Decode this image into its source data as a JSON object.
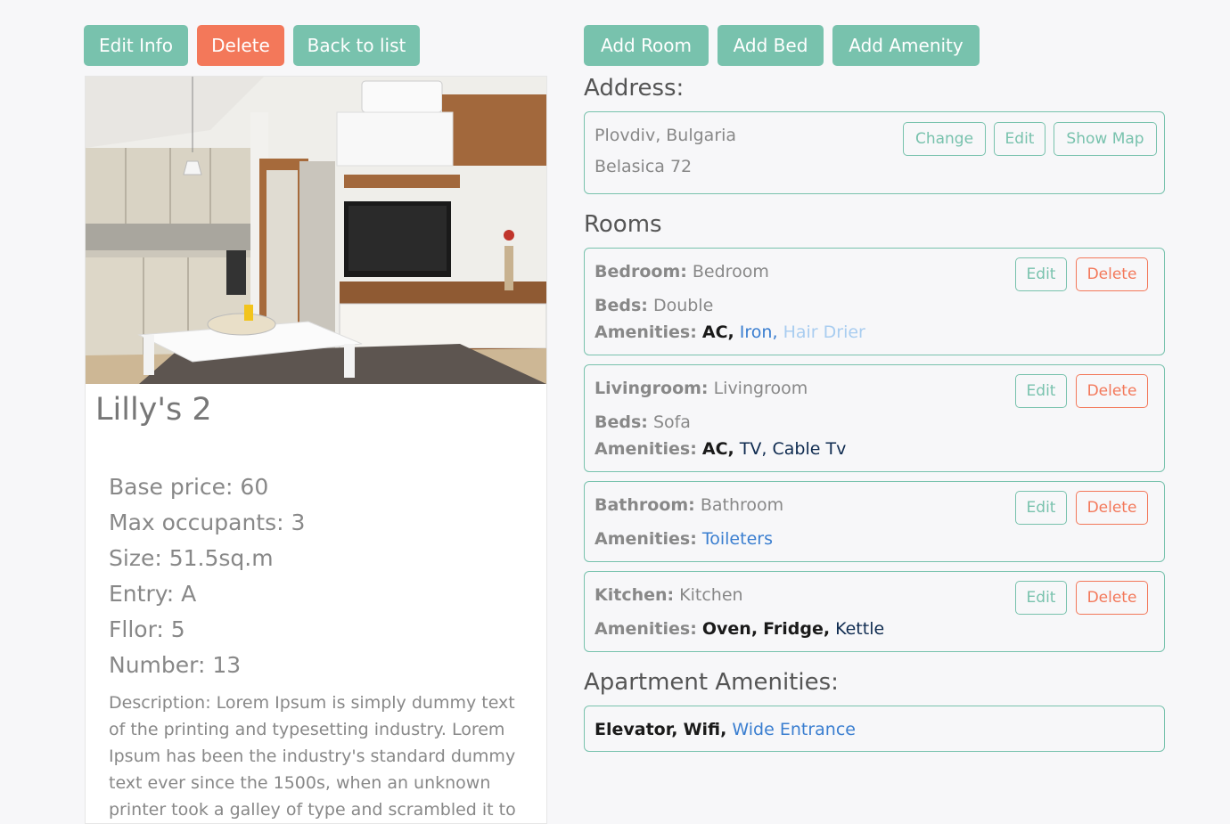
{
  "left_toolbar": {
    "edit_info": "Edit Info",
    "delete": "Delete",
    "back_to_list": "Back to list"
  },
  "right_toolbar": {
    "add_room": "Add Room",
    "add_bed": "Add Bed",
    "add_amenity": "Add Amenity"
  },
  "apartment": {
    "title": "Lilly's 2",
    "base_price": "Base price: 60",
    "max_occupants": "Max occupants: 3",
    "size": "Size: 51.5sq.m",
    "entry": "Entry: A",
    "floor": "Fllor: 5",
    "number": "Number: 13",
    "description": "Description: Lorem Ipsum is simply dummy text of the printing and typesetting industry. Lorem Ipsum has been the industry's standard dummy text ever since the 1500s, when an unknown printer took a galley of type and scrambled it to make a type"
  },
  "address": {
    "heading": "Address:",
    "city": "Plovdiv, Bulgaria",
    "street": "Belasica 72",
    "change": "Change",
    "edit": "Edit",
    "show_map": "Show Map"
  },
  "rooms": {
    "heading": "Rooms",
    "beds_label": "Beds:",
    "amenities_label": "Amenities:",
    "edit": "Edit",
    "delete": "Delete",
    "items": [
      {
        "type": "Bedroom:",
        "name": "Bedroom",
        "beds": "Double",
        "amenities": [
          "AC,",
          "Iron,",
          "Hair Drier"
        ]
      },
      {
        "type": "Livingroom:",
        "name": "Livingroom",
        "beds": "Sofa",
        "amenities": [
          "AC,",
          "TV,",
          "Cable Tv"
        ]
      },
      {
        "type": "Bathroom:",
        "name": "Bathroom",
        "amenities": [
          "Toileters"
        ]
      },
      {
        "type": "Kitchen:",
        "name": "Kitchen",
        "amenities": [
          "Oven,",
          "Fridge,",
          "Kettle"
        ]
      }
    ]
  },
  "apartment_amenities": {
    "heading": "Apartment Amenities:",
    "items": [
      "Elevator,",
      "Wifi,",
      "Wide Entrance"
    ]
  },
  "colors": {
    "primary": "#78c2ad",
    "danger": "#f3785a",
    "background": "#f7f7f9"
  }
}
